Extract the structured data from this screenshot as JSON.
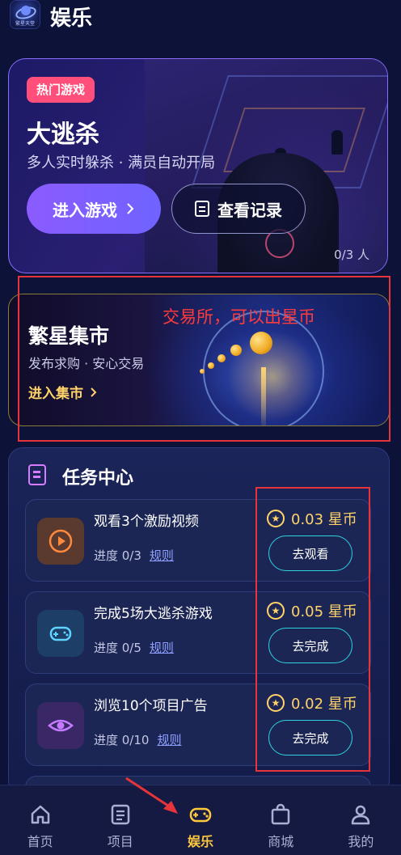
{
  "header": {
    "logo_text": "繁星天堂",
    "title": "娱乐"
  },
  "hero": {
    "badge": "热门游戏",
    "title": "大逃杀",
    "subtitle": "多人实时躲杀 · 满员自动开局",
    "enter_label": "进入游戏",
    "records_label": "查看记录",
    "player_count": "0/3 人"
  },
  "market": {
    "annotation": "交易所，可以出星币",
    "title": "繁星集市",
    "subtitle": "发布求购 · 安心交易",
    "enter_label": "进入集市"
  },
  "tasks": {
    "title": "任务中心",
    "items": [
      {
        "name": "观看3个激励视频",
        "progress": "进度 0/3",
        "rule": "规则",
        "reward": "0.03 星币",
        "button": "去观看",
        "icon": "play-icon",
        "icon_color": "#ff8a3d"
      },
      {
        "name": "完成5场大逃杀游戏",
        "progress": "进度 0/5",
        "rule": "规则",
        "reward": "0.05 星币",
        "button": "去完成",
        "icon": "gamepad-icon",
        "icon_color": "#5fd3ff"
      },
      {
        "name": "浏览10个项目广告",
        "progress": "进度 0/10",
        "rule": "规则",
        "reward": "0.02 星币",
        "button": "去完成",
        "icon": "eye-icon",
        "icon_color": "#c37bff"
      }
    ]
  },
  "nav": {
    "items": [
      {
        "label": "首页",
        "icon": "home-icon",
        "active": false
      },
      {
        "label": "项目",
        "icon": "list-icon",
        "active": false
      },
      {
        "label": "娱乐",
        "icon": "gamepad-icon",
        "active": true
      },
      {
        "label": "商城",
        "icon": "shopping-bag-icon",
        "active": false
      },
      {
        "label": "我的",
        "icon": "user-icon",
        "active": false
      }
    ]
  },
  "colors": {
    "background": "#0d1238",
    "accent_purple": "#8b5bff",
    "badge_red": "#ff4f7a",
    "coin_gold": "#ffd36a",
    "button_cyan": "#2ed3e0",
    "nav_active": "#ffc83d",
    "annotation_red": "#e5353b"
  }
}
